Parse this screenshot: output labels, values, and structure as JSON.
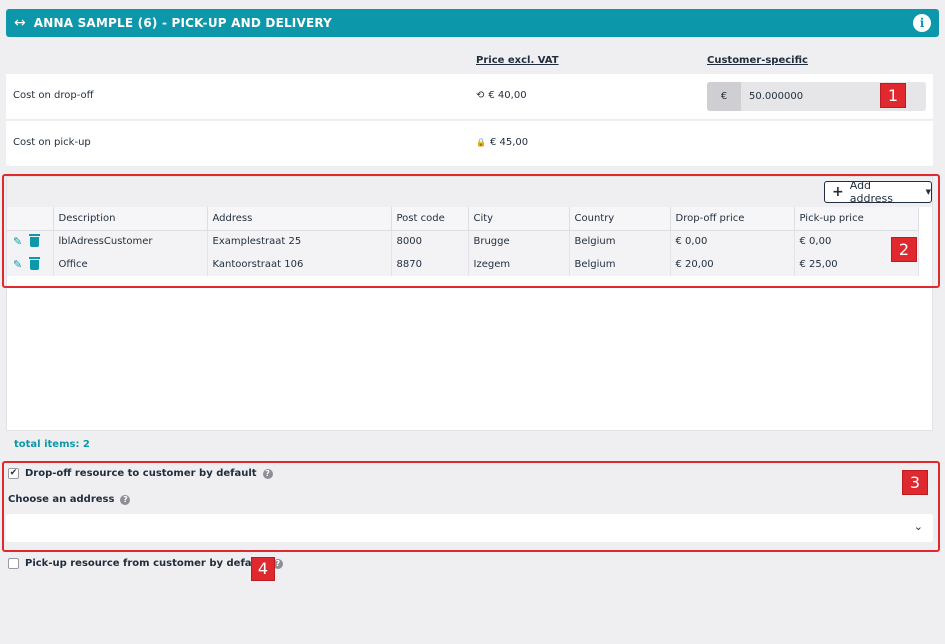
{
  "header": {
    "arrow_glyph": "↔",
    "title": "ANNA SAMPLE (6) - PICK-UP AND DELIVERY",
    "info_glyph": "i",
    "color": "#0d97aa"
  },
  "columns": {
    "price_excl_vat": "Price excl. VAT",
    "customer_specific": "Customer-specific"
  },
  "costs": {
    "dropoff": {
      "label": "Cost on drop-off",
      "icon": "reset-icon",
      "icon_glyph": "⟲",
      "price": "€ 40,00",
      "currency": "€",
      "custom_value": "50.000000"
    },
    "pickup": {
      "label": "Cost on pick-up",
      "icon": "lock-icon",
      "icon_glyph": "🔒",
      "price": "€ 45,00"
    }
  },
  "addresses": {
    "add_button": "Add address",
    "add_glyph": "+",
    "caret_glyph": "▼",
    "headers": [
      "Description",
      "Address",
      "Post code",
      "City",
      "Country",
      "Drop-off price",
      "Pick-up price"
    ],
    "rows": [
      {
        "description": "lblAdressCustomer",
        "address": "Examplestraat 25",
        "postcode": "8000",
        "city": "Brugge",
        "country": "Belgium",
        "dropoff": "€ 0,00",
        "pickup": "€ 0,00"
      },
      {
        "description": "Office",
        "address": "Kantoorstraat 106",
        "postcode": "8870",
        "city": "Izegem",
        "country": "Belgium",
        "dropoff": "€ 20,00",
        "pickup": "€ 25,00"
      }
    ],
    "pencil_glyph": "✎",
    "total": "total items: 2"
  },
  "options": {
    "dropoff_default": {
      "label": "Drop-off resource to customer by default",
      "checked": true,
      "check_glyph": "✔"
    },
    "choose_address": {
      "label": "Choose an address",
      "value": ""
    },
    "pickup_default": {
      "label": "Pick-up resource from customer by default",
      "checked": false
    },
    "help_glyph": "?",
    "chevron_glyph": "⌄"
  },
  "callouts": [
    "1",
    "2",
    "3",
    "4"
  ],
  "accent_color": "#e0282f"
}
